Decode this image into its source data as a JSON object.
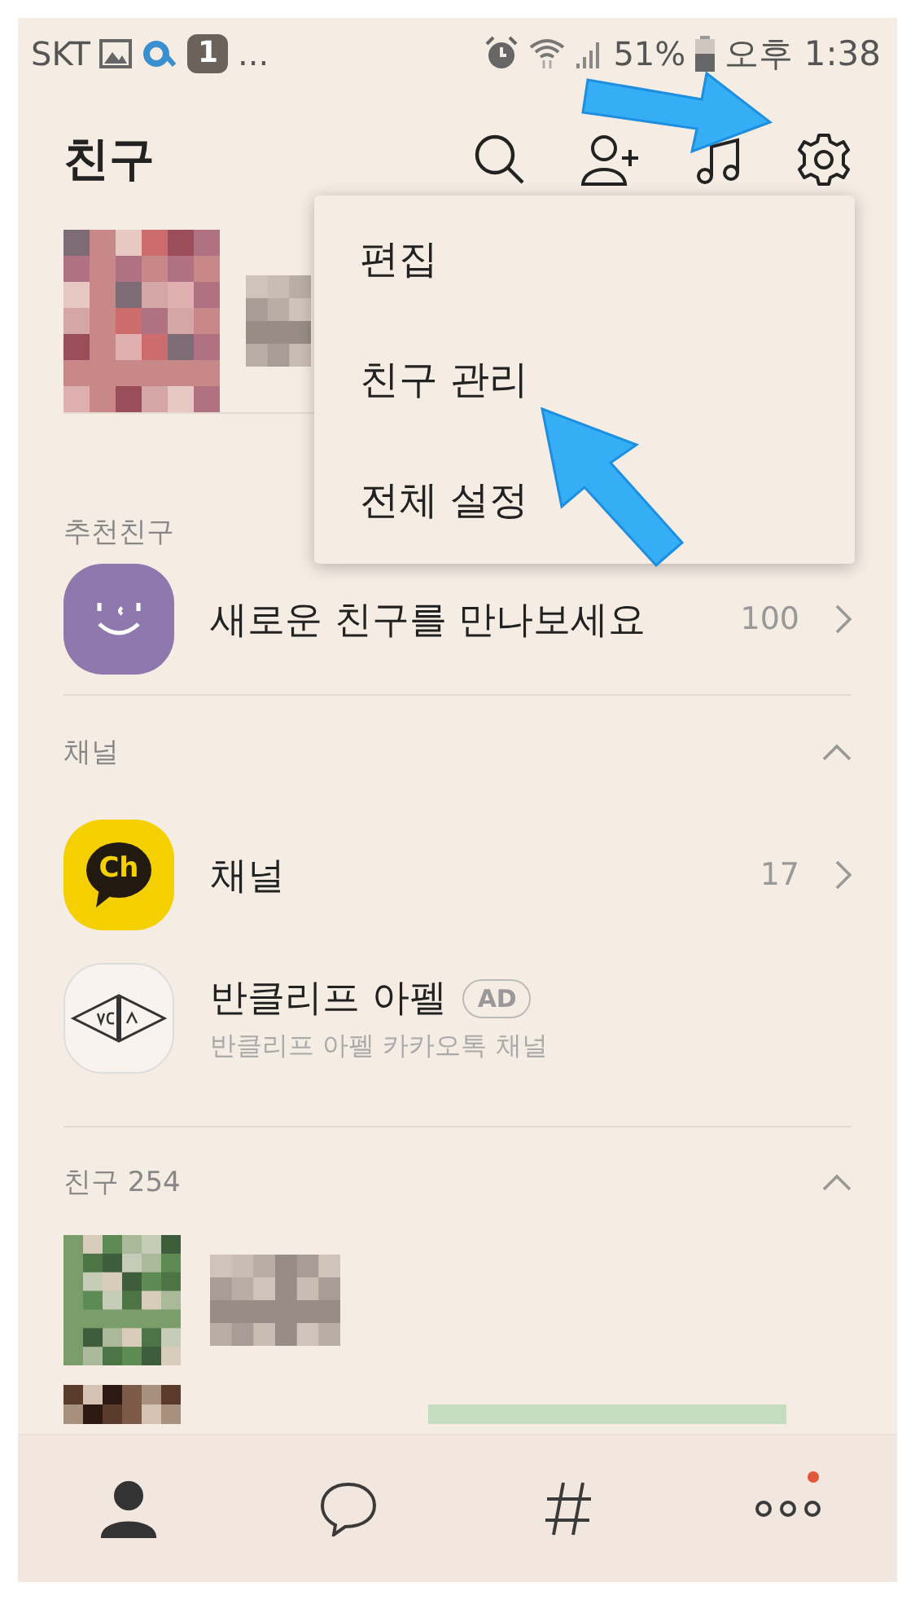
{
  "status_bar": {
    "carrier": "SKT",
    "notification_count": "1",
    "more": "...",
    "battery": "51%",
    "time": "오후 1:38"
  },
  "header": {
    "title": "친구"
  },
  "menu": {
    "items": [
      {
        "label": "편집"
      },
      {
        "label": "친구 관리"
      },
      {
        "label": "전체 설정"
      }
    ]
  },
  "recommended": {
    "title": "추천친구",
    "item": {
      "name": "새로운 친구를 만나보세요",
      "count": "100"
    }
  },
  "channels": {
    "title": "채널",
    "expanded": true,
    "items": [
      {
        "kind": "channel",
        "logo_text": "Ch",
        "name": "채널",
        "count": "17"
      },
      {
        "kind": "ad",
        "name": "반클리프 아펠",
        "badge": "AD",
        "subtitle": "반클리프 아펠 카카오톡 채널"
      }
    ]
  },
  "friends": {
    "title": "친구 254",
    "expanded": true
  },
  "tabs": [
    {
      "kind": "friends",
      "selected": true
    },
    {
      "kind": "chats",
      "selected": false
    },
    {
      "kind": "view",
      "selected": false
    },
    {
      "kind": "more",
      "selected": false,
      "badge": true
    }
  ]
}
